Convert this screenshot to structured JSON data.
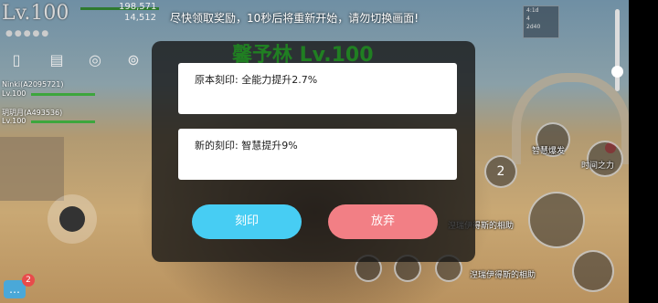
{
  "hud": {
    "level": "Lv.100",
    "hp_current": "198,571",
    "hp_secondary": "14,512",
    "notice": "尽快领取奖励，10秒后将重新开始，请勿切换画面!",
    "minimap_lines": [
      "4:1d",
      "4",
      "2d40"
    ],
    "zone_title": "馨予林 Lv.100"
  },
  "party": [
    {
      "name": "Ninki(A2095721)",
      "level": "Lv.100"
    },
    {
      "name": "玥玥月(A493536)",
      "level": "Lv.100"
    }
  ],
  "chat": {
    "badge_count": "2"
  },
  "skills": [
    {
      "label": "智慧爆发"
    },
    {
      "label": "时间之力"
    },
    {
      "label": "湼瑞伊得斯的相助"
    },
    {
      "label": "湼瑞伊得斯的相助"
    },
    {
      "label": "2"
    }
  ],
  "dialog": {
    "original_label": "原本刻印: 全能力提升2.7%",
    "new_label": "新的刻印: 智慧提升9%",
    "engrave_button": "刻印",
    "abandon_button": "放弃"
  },
  "colors": {
    "engrave_button": "#47cdf3",
    "abandon_button": "#f27f85",
    "zone_title": "#1f8d1f"
  },
  "icons": [
    "phone-icon",
    "notebook-icon",
    "globe-icon",
    "network-icon",
    "chat-icon",
    "joystick-icon"
  ]
}
